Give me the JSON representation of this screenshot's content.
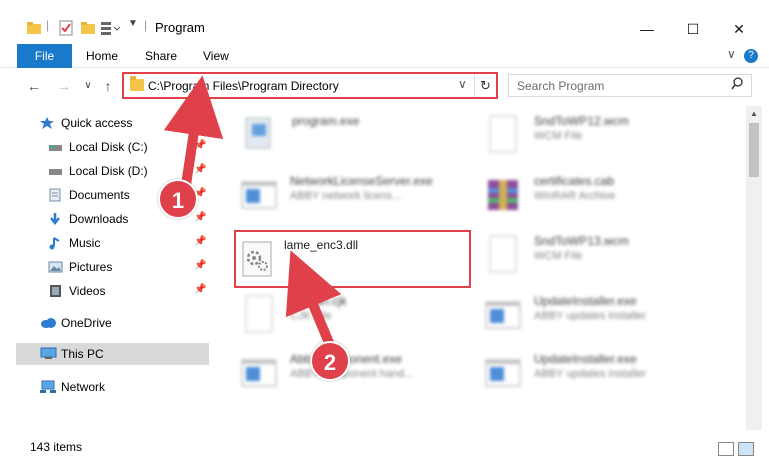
{
  "window": {
    "title": "Program",
    "minimize": "—",
    "maximize": "☐",
    "close": "✕"
  },
  "ribbon": {
    "file": "File",
    "home": "Home",
    "share": "Share",
    "view": "View",
    "expand": "∨",
    "help": "?"
  },
  "nav": {
    "back": "←",
    "forward": "→",
    "recent": "∨",
    "up": "↑"
  },
  "address": {
    "path": "C:\\Program Files\\Program Directory",
    "dropdown": "∨",
    "refresh": "↻"
  },
  "search": {
    "placeholder": "Search Program",
    "icon": "search-icon"
  },
  "sidebar": {
    "items": [
      {
        "label": "Quick access",
        "icon": "star-icon"
      },
      {
        "label": "Local Disk (C:)",
        "icon": "drive-icon",
        "pinned": true
      },
      {
        "label": "Local Disk (D:)",
        "icon": "drive-icon",
        "pinned": true
      },
      {
        "label": "Documents",
        "icon": "documents-icon",
        "pinned": true
      },
      {
        "label": "Downloads",
        "icon": "download-icon",
        "pinned": true
      },
      {
        "label": "Music",
        "icon": "music-icon",
        "pinned": true
      },
      {
        "label": "Pictures",
        "icon": "pictures-icon",
        "pinned": true
      },
      {
        "label": "Videos",
        "icon": "videos-icon",
        "pinned": true
      },
      {
        "label": "OneDrive",
        "icon": "cloud-icon"
      },
      {
        "label": "This PC",
        "icon": "computer-icon",
        "selected": true
      },
      {
        "label": "Network",
        "icon": "network-icon"
      }
    ],
    "pin_glyph": "✕"
  },
  "files": [
    {
      "name": "program.exe",
      "type": "",
      "icon": "exe-icon",
      "blurred": true
    },
    {
      "name": "SndToWP12.wcm",
      "type": "WCM File",
      "icon": "document-icon",
      "blurred": true
    },
    {
      "name": "NetworkLicenseServer.exe",
      "type": "ABBY network licens...",
      "icon": "app-window-icon",
      "blurred": true
    },
    {
      "name": "certificates.cab",
      "type": "WinRAR Archive",
      "icon": "archive-icon",
      "blurred": true
    },
    {
      "name": "lame_enc3.dll",
      "type": "",
      "icon": "dll-gear-icon",
      "blurred": false
    },
    {
      "name": "SndToWP13.wcm",
      "type": "WCM File",
      "icon": "document-icon",
      "blurred": true
    },
    {
      "name": "Korean.cjk",
      "type": "CJK File",
      "icon": "document-icon",
      "blurred": true
    },
    {
      "name": "UpdateInstaller.exe",
      "type": "ABBY updates installer",
      "icon": "app-window-icon",
      "blurred": true
    },
    {
      "name": "AbbyComponent.exe",
      "type": "ABBY component hand...",
      "icon": "app-window-icon",
      "blurred": true
    },
    {
      "name": "UpdateInstaller.exe",
      "type": "ABBY updates installer",
      "icon": "app-window-icon",
      "blurred": true
    }
  ],
  "callouts": {
    "step1": "1",
    "step2": "2"
  },
  "status": {
    "count": "143 items"
  },
  "colors": {
    "accent": "#1979ca",
    "highlight": "#e0404a"
  }
}
